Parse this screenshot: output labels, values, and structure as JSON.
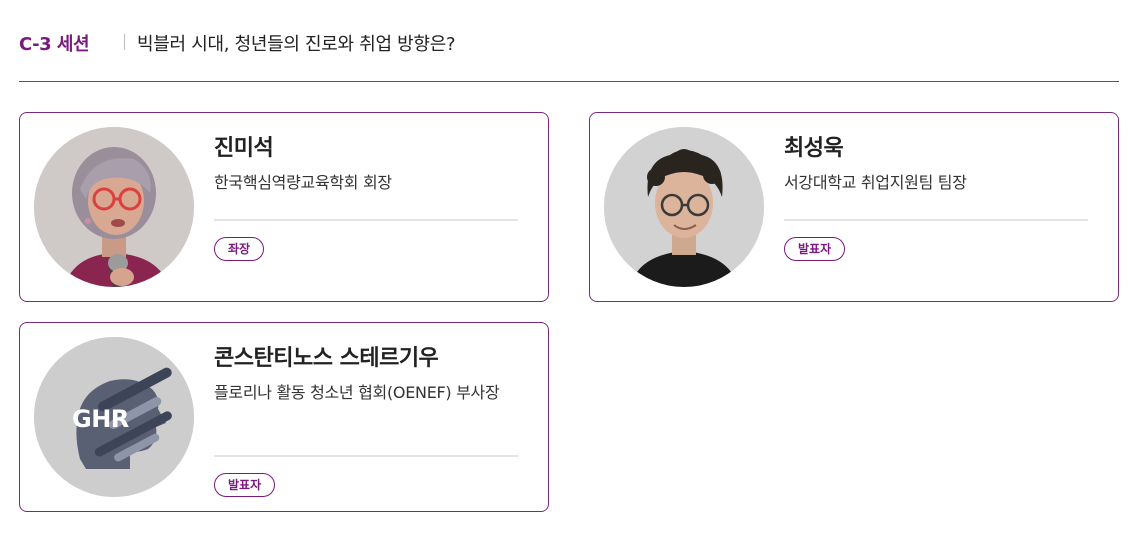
{
  "session": {
    "code": "C-3 세션",
    "title": "빅블러 시대, 청년들의 진로와 취업 방향은?"
  },
  "speakers": [
    {
      "name": "진미석",
      "affiliation": "한국핵심역량교육학회 회장",
      "role": "좌장",
      "photo": "person-photo-woman-glasses-microphone"
    },
    {
      "name": "최성욱",
      "affiliation": "서강대학교 취업지원팀 팀장",
      "role": "발표자",
      "photo": "person-photo-man-glasses"
    },
    {
      "name": "콘스탄티노스 스테르기우",
      "affiliation": "플로리나 활동 청소년 협회(OENEF) 부사장",
      "role": "발표자",
      "logo_text": "GHR",
      "photo": "ghr-logo"
    }
  ],
  "colors": {
    "accent": "#7a1a7e",
    "card_border": "#7a2a80",
    "avatar_bg": "#d3d3d3",
    "divider": "#e4e4e4"
  }
}
